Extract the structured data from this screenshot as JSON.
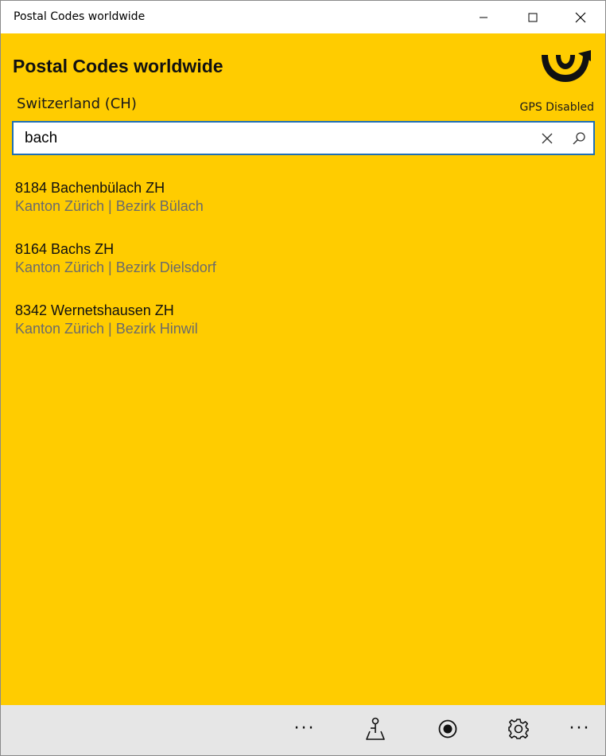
{
  "window": {
    "title": "Postal Codes worldwide"
  },
  "header": {
    "app_title": "Postal Codes worldwide",
    "country": "Switzerland (CH)",
    "gps_status": "GPS Disabled",
    "logo_icon": "posthorn-logo-icon"
  },
  "search": {
    "value": "bach",
    "clear_icon": "close-icon",
    "search_icon": "search-icon"
  },
  "results": [
    {
      "title": "8184 Bachenbülach ZH",
      "subtitle": "Kanton Zürich | Bezirk Bülach"
    },
    {
      "title": "8164 Bachs ZH",
      "subtitle": "Kanton Zürich | Bezirk Dielsdorf"
    },
    {
      "title": "8342 Wernetshausen ZH",
      "subtitle": "Kanton Zürich | Bezirk Hinwil"
    }
  ],
  "appbar": {
    "buttons": [
      "more-icon",
      "map-pin-icon",
      "locate-icon",
      "settings-icon",
      "ellipsis-icon"
    ],
    "more_label": "···",
    "overflow_label": "···"
  },
  "colors": {
    "background": "#ffcc00",
    "accent_border": "#1f6fb5",
    "subtitle_text": "#6b6b6b",
    "appbar": "#e6e6e6"
  }
}
